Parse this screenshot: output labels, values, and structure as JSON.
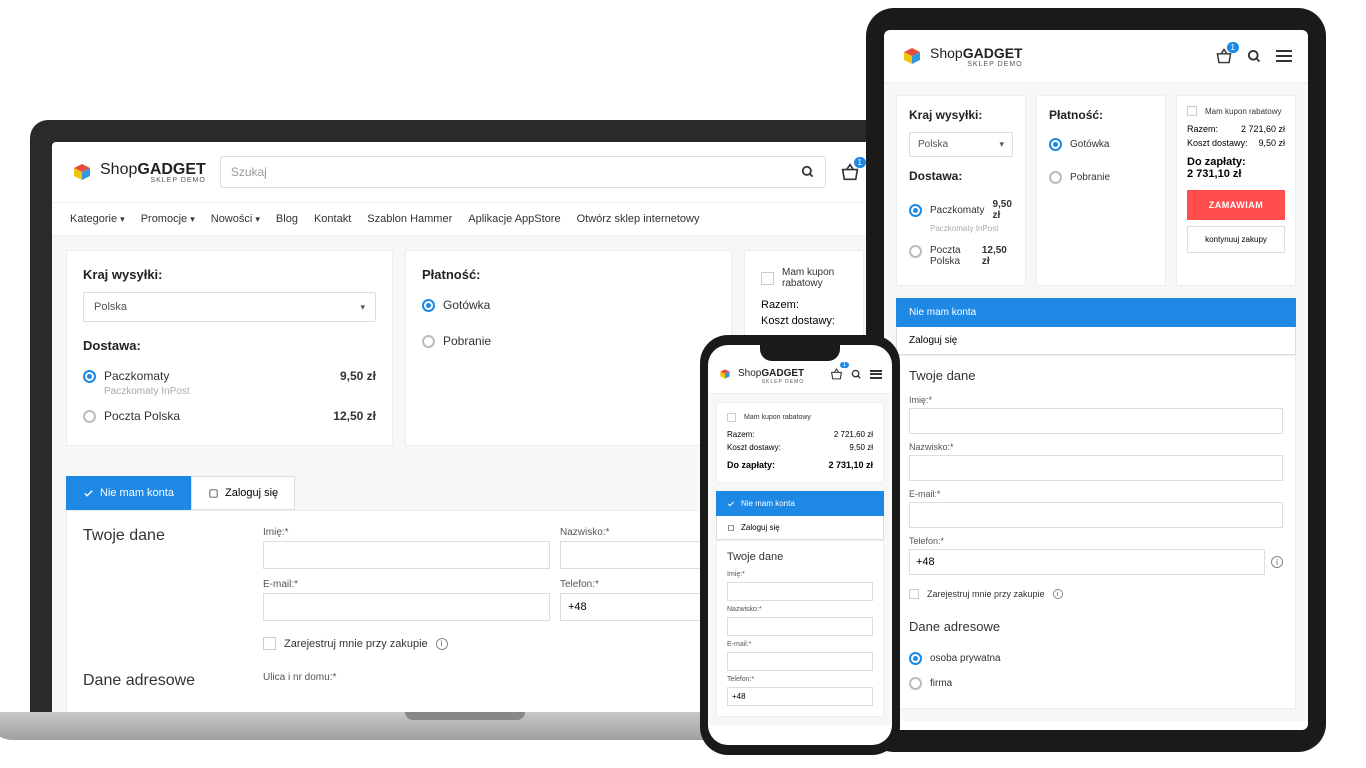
{
  "brand": {
    "name_a": "Shop",
    "name_b": "GADGET",
    "tag": "SKLEP DEMO"
  },
  "search": {
    "placeholder": "Szukaj"
  },
  "cart_count": "1",
  "nav": [
    "Kategorie",
    "Promocje",
    "Nowości",
    "Blog",
    "Kontakt",
    "Szablon Hammer",
    "Aplikacje AppStore",
    "Otwórz sklep internetowy"
  ],
  "shipping": {
    "country_h": "Kraj wysyłki:",
    "country": "Polska",
    "delivery_h": "Dostawa:",
    "opt1": "Paczkomaty",
    "opt1_sub": "Paczkomaty InPost",
    "opt1_price": "9,50 zł",
    "opt2": "Poczta Polska",
    "opt2_price": "12,50 zł"
  },
  "payment": {
    "h": "Płatność:",
    "opt1": "Gotówka",
    "opt2": "Pobranie"
  },
  "summary": {
    "coupon": "Mam kupon rabatowy",
    "sum_l": "Razem:",
    "sum_v": "2 721,60 zł",
    "ship_l": "Koszt dostawy:",
    "ship_v": "9,50 zł",
    "total_l": "Do zapłaty:",
    "total_v": "2 731,10 zł",
    "order": "ZAMAWIAM",
    "cont": "kontynuuj zakupy"
  },
  "tabs": {
    "no_account": "Nie mam konta",
    "login": "Zaloguj się"
  },
  "form": {
    "h1": "Twoje dane",
    "h2": "Dane adresowe",
    "fname": "Imię:*",
    "lname": "Nazwisko:*",
    "email": "E-mail:*",
    "phone": "Telefon:*",
    "phone_prefix": "+48",
    "register": "Zarejestruj mnie przy zakupie",
    "street": "Ulica i nr domu:*",
    "private": "osoba prywatna",
    "company": "firma"
  }
}
